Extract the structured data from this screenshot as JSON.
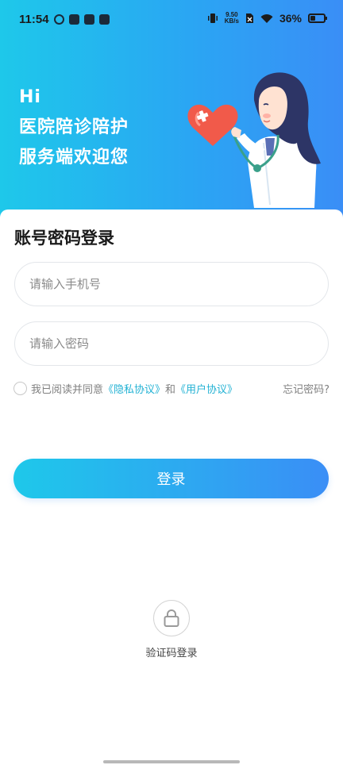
{
  "status_bar": {
    "time": "11:54",
    "net_speed_value": "9.50",
    "net_speed_unit": "KB/s",
    "battery": "36%"
  },
  "header": {
    "greeting_line1": "Hi",
    "greeting_line2": "医院陪诊陪护",
    "greeting_line3": "服务端欢迎您"
  },
  "login": {
    "title": "账号密码登录",
    "phone_placeholder": "请输入手机号",
    "password_placeholder": "请输入密码",
    "agreement_prefix": "我已阅读并同意",
    "privacy_link": "《隐私协议》",
    "agreement_and": "和",
    "user_link": "《用户协议》",
    "forgot": "忘记密码?",
    "button": "登录"
  },
  "alt_login": {
    "label": "验证码登录"
  },
  "colors": {
    "gradient_start": "#1ec8ea",
    "gradient_end": "#3a8ef6",
    "link": "#23b2d4"
  }
}
